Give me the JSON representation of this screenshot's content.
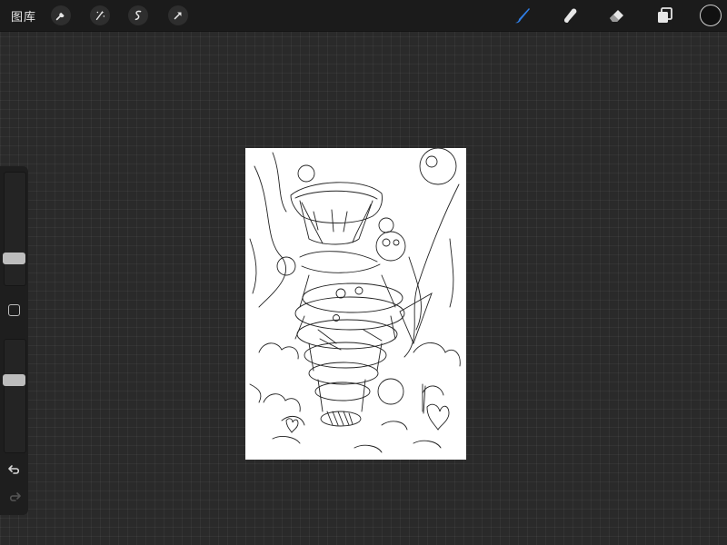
{
  "topbar": {
    "gallery_label": "图库",
    "tools_left": [
      "wrench-icon",
      "magic-wand-icon",
      "selection-icon",
      "transform-arrow-icon"
    ],
    "tools_right": [
      "brush-icon",
      "smudge-icon",
      "eraser-icon",
      "layers-icon"
    ],
    "active_tool": "brush",
    "accent_color": "#2f7ee6",
    "current_color": "#111111"
  },
  "sidebar": {
    "brush_size_level": 0.32,
    "opacity_level": 0.42,
    "controls": [
      "brush-size-slider",
      "modify-button",
      "opacity-slider",
      "undo-button",
      "redo-button"
    ]
  },
  "canvas": {
    "background": "#ffffff",
    "content": "pencil sketch"
  }
}
